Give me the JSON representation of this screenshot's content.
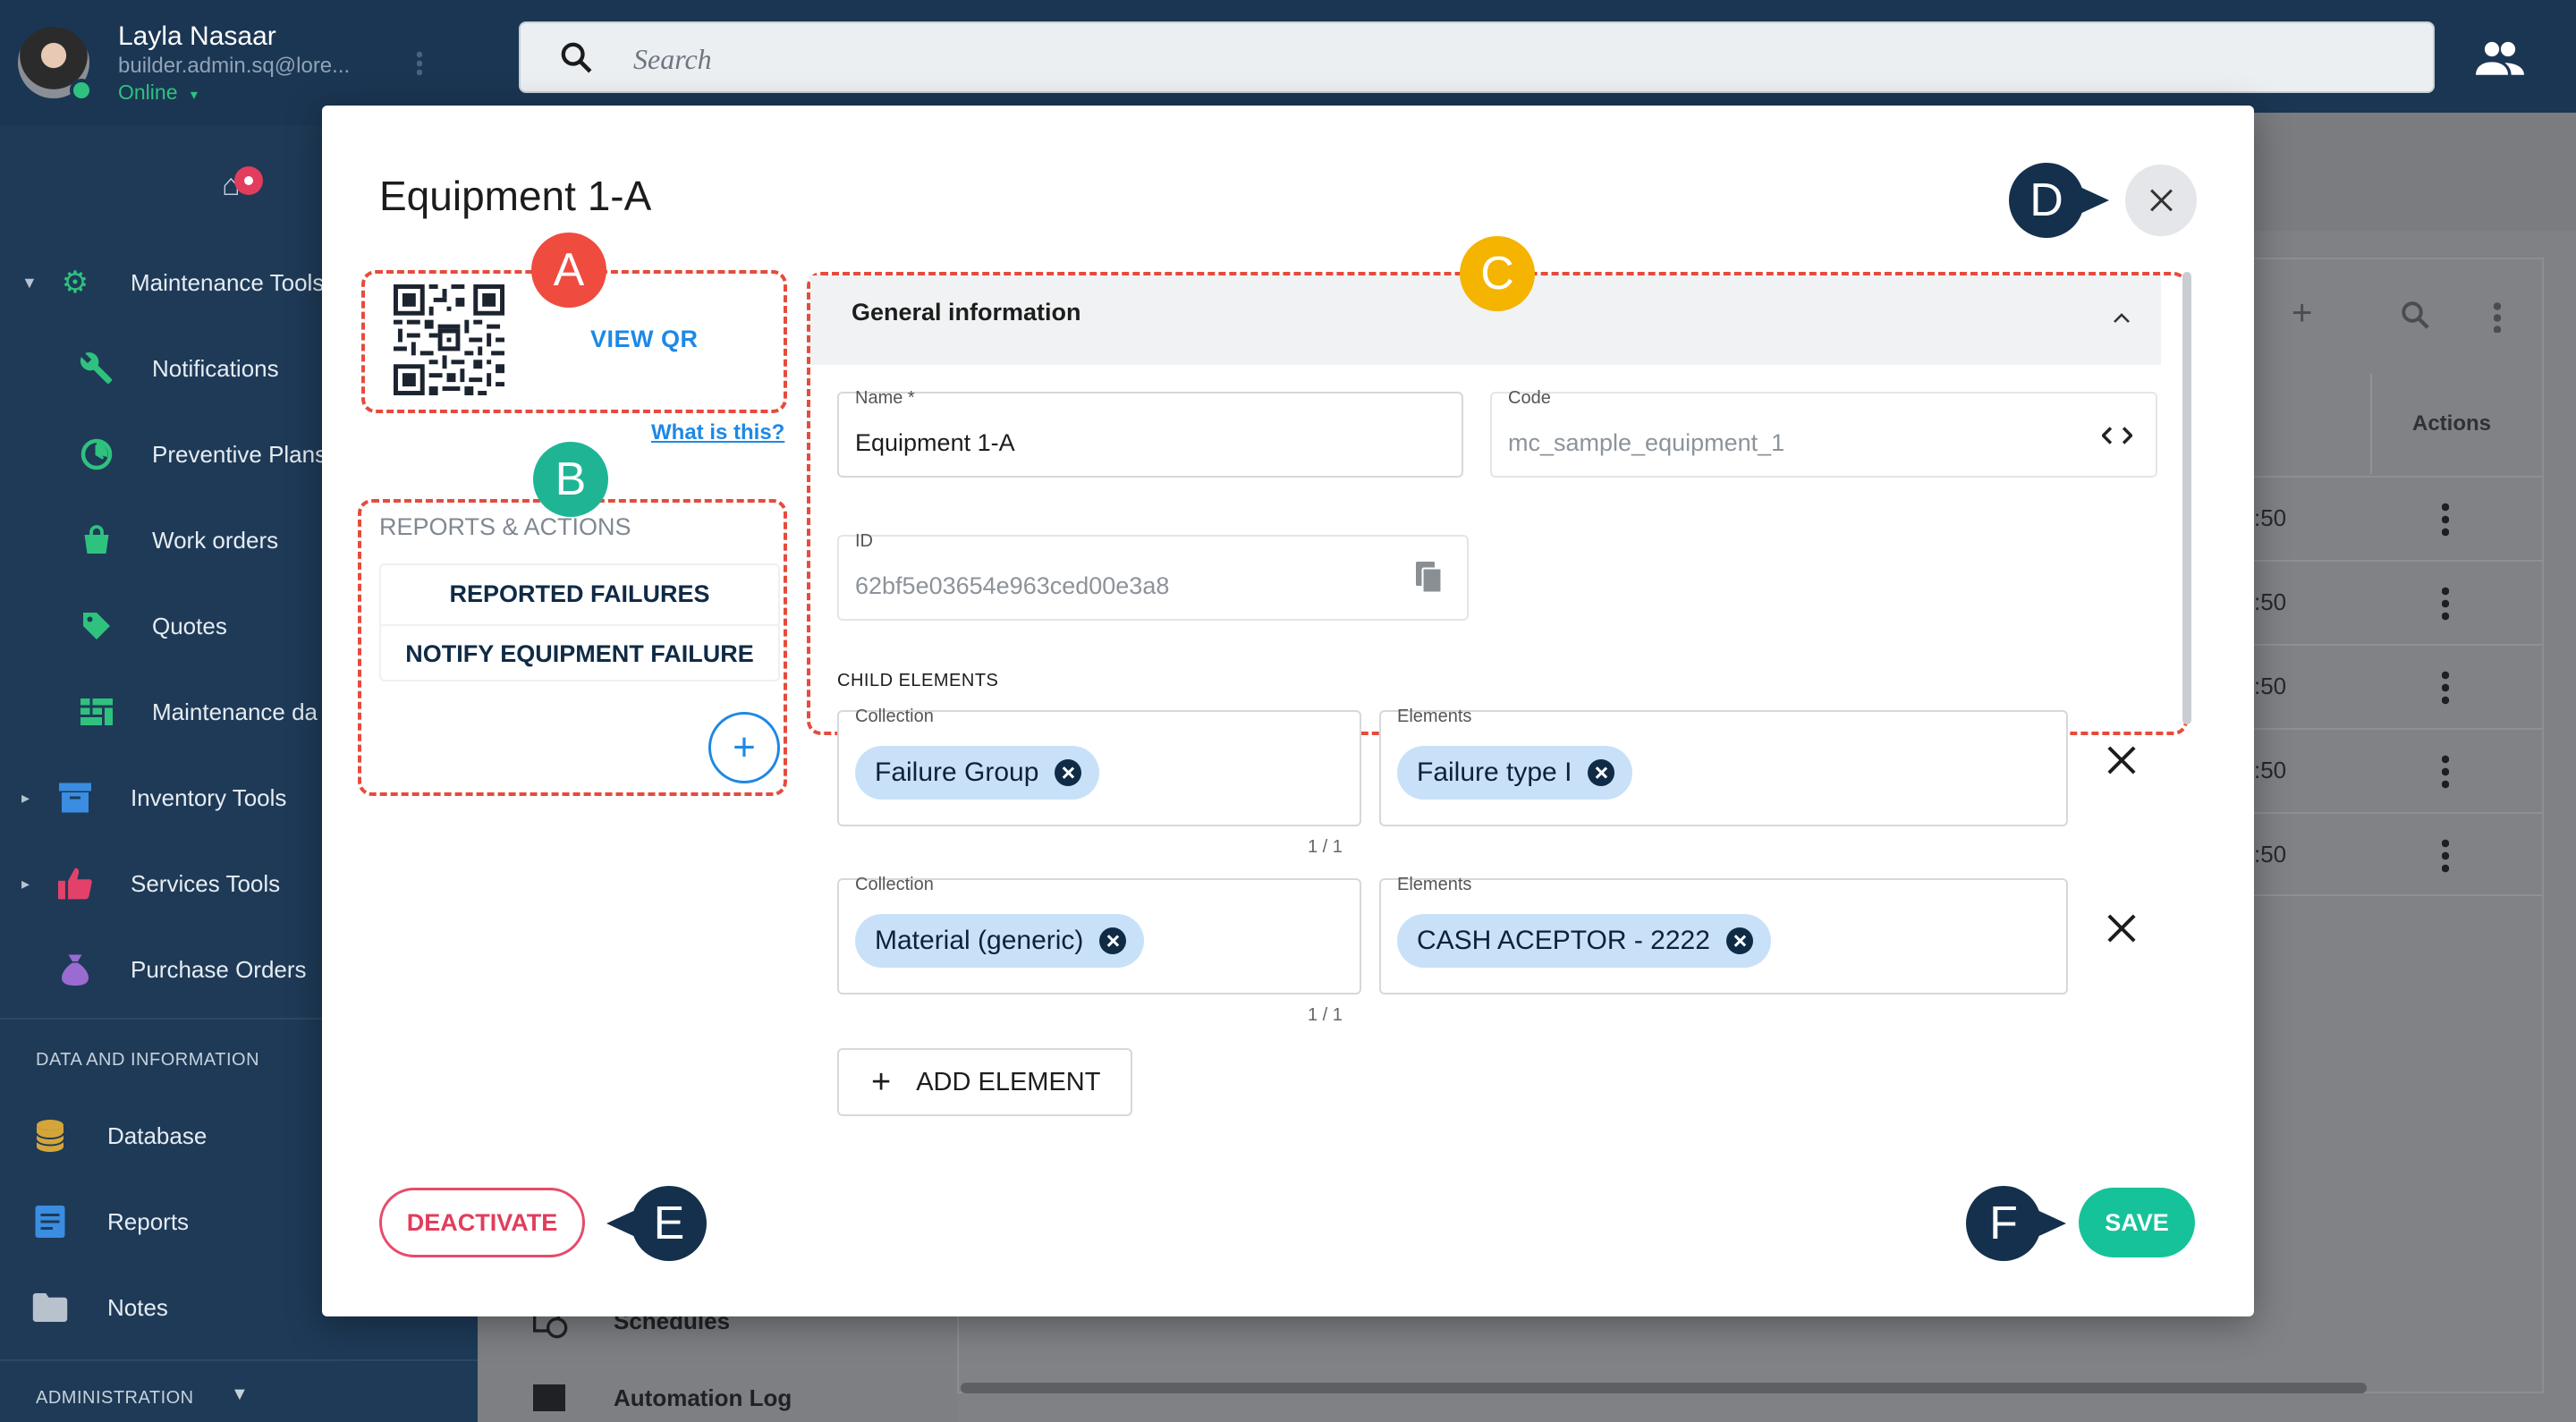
{
  "user": {
    "name": "Layla Nasaar",
    "email": "builder.admin.sq@lore...",
    "status": "Online"
  },
  "search": {
    "placeholder": "Search"
  },
  "sidebar": {
    "items": [
      {
        "label": "Maintenance Tools",
        "icon": "gear-icon"
      },
      {
        "label": "Notifications",
        "icon": "wrench-icon"
      },
      {
        "label": "Preventive Plans",
        "icon": "clock-icon"
      },
      {
        "label": "Work orders",
        "icon": "bag-icon"
      },
      {
        "label": "Quotes",
        "icon": "tag-icon"
      },
      {
        "label": "Maintenance da",
        "icon": "grid-icon"
      },
      {
        "label": "Inventory Tools",
        "icon": "archive-icon"
      },
      {
        "label": "Services Tools",
        "icon": "thumb-up-icon"
      },
      {
        "label": "Purchase Orders",
        "icon": "money-bag-icon"
      }
    ],
    "data_section": "DATA AND INFORMATION",
    "data_items": [
      {
        "label": "Database",
        "icon": "database-icon"
      },
      {
        "label": "Reports",
        "icon": "report-icon"
      },
      {
        "label": "Notes",
        "icon": "folder-icon"
      }
    ],
    "admin_section": "ADMINISTRATION"
  },
  "background": {
    "actions_header": "Actions",
    "row_times": [
      ":50",
      ":50",
      ":50",
      ":50",
      ":50"
    ],
    "list_items": [
      "Schedules",
      "Automation Log"
    ]
  },
  "modal": {
    "title": "Equipment 1-A",
    "view_qr": "VIEW QR",
    "what_is_this": "What is this?",
    "reports_label": "REPORTS & ACTIONS",
    "reports": [
      "REPORTED FAILURES",
      "NOTIFY EQUIPMENT FAILURE"
    ],
    "general_info": "General information",
    "name_label": "Name *",
    "name_value": "Equipment 1-A",
    "code_label": "Code",
    "code_value": "mc_sample_equipment_1",
    "id_label": "ID",
    "id_value": "62bf5e03654e963ced00e3a8",
    "child_elements": "CHILD ELEMENTS",
    "children": [
      {
        "collection_label": "Collection",
        "collection": "Failure Group",
        "elements_label": "Elements",
        "element": "Failure type I",
        "counter": "1 / 1"
      },
      {
        "collection_label": "Collection",
        "collection": "Material (generic)",
        "elements_label": "Elements",
        "element": "CASH ACEPTOR - 2222",
        "counter": "1 / 1"
      }
    ],
    "add_element": "ADD ELEMENT",
    "deactivate": "DEACTIVATE",
    "save": "SAVE"
  },
  "markers": [
    "A",
    "B",
    "C",
    "D",
    "E",
    "F"
  ],
  "colors": {
    "accent": "#1e88e5",
    "save": "#16c29a",
    "danger": "#e23d5c",
    "sidebar": "#1e3a57",
    "callout_a": "#ef4b3e",
    "callout_b": "#1fb594",
    "callout_c": "#f4b400",
    "callout_pin": "#14304d"
  }
}
